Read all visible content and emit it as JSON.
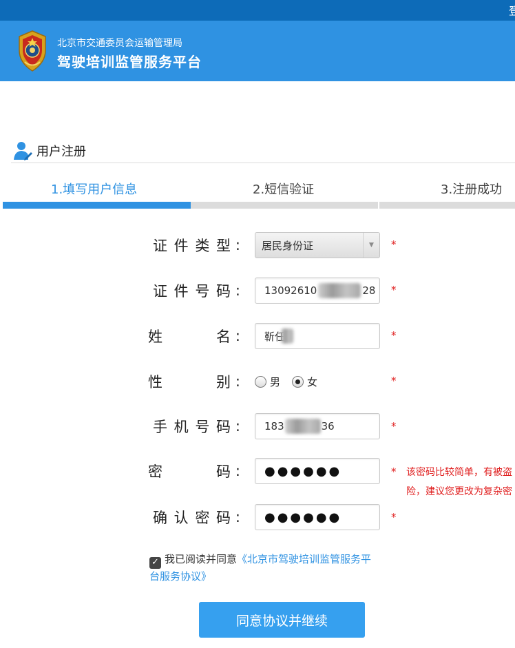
{
  "topbar": {
    "login_label": "登"
  },
  "header": {
    "org_name": "北京市交通委员会运输管理局",
    "platform_name": "驾驶培训监管服务平台"
  },
  "section": {
    "title": "用户注册"
  },
  "steps": [
    {
      "label": "1.填写用户信息",
      "active": true
    },
    {
      "label": "2.短信验证",
      "active": false
    },
    {
      "label": "3.注册成功",
      "active": false
    }
  ],
  "form": {
    "id_type": {
      "label_chars": [
        "证",
        "件",
        "类",
        "型"
      ],
      "colon": ":",
      "value": "居民身份证"
    },
    "id_number": {
      "label_chars": [
        "证",
        "件",
        "号",
        "码"
      ],
      "colon": ":",
      "value_prefix": "13092610",
      "value_suffix": "28"
    },
    "name": {
      "label_chars": [
        "姓",
        "名"
      ],
      "colon": ":",
      "value_prefix": "靳任"
    },
    "gender": {
      "label_chars": [
        "性",
        "别"
      ],
      "colon": ":",
      "options": [
        {
          "label": "男",
          "selected": false
        },
        {
          "label": "女",
          "selected": true
        }
      ]
    },
    "phone": {
      "label_chars": [
        "手",
        "机",
        "号",
        "码"
      ],
      "colon": ":",
      "value_prefix": "183",
      "value_suffix": "36"
    },
    "password": {
      "label_chars": [
        "密",
        "码"
      ],
      "colon": ":",
      "masked": "●●●●●●"
    },
    "confirm_password": {
      "label_chars": [
        "确",
        "认",
        "密",
        "码"
      ],
      "colon": ":",
      "masked": "●●●●●●"
    },
    "required_mark": "*"
  },
  "password_warning": {
    "line1": "该密码比较简单，有被盗",
    "line2": "险，建议您更改为复杂密"
  },
  "agreement": {
    "checked": true,
    "text": "我已阅读并同意",
    "link": "《北京市驾驶培训监管服务平台服务协议》"
  },
  "submit": {
    "label": "同意协议并继续"
  },
  "colors": {
    "header_blue": "#2f92e2",
    "topbar_blue": "#0d6bb8",
    "required_red": "#e02020",
    "button_blue": "#36a0ef"
  }
}
